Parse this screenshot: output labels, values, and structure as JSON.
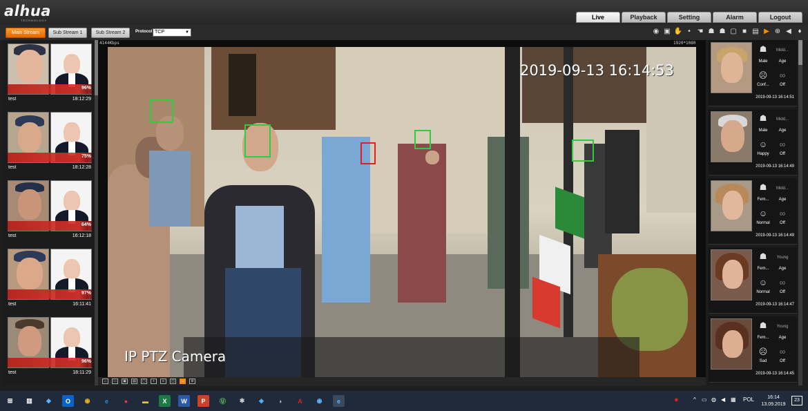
{
  "brand": {
    "logo": "alhua",
    "tagline": "TECHNOLOGY"
  },
  "nav": {
    "tabs": [
      "Live",
      "Playback",
      "Setting",
      "Alarm",
      "Logout"
    ],
    "active": "Live"
  },
  "streams": {
    "main": "Main Stream",
    "sub1": "Sub Stream 1",
    "sub2": "Sub Stream 2"
  },
  "protocol": {
    "label": "Protocol",
    "value": "TCP"
  },
  "video": {
    "bitrate": "4144Kbps",
    "resolution": "1920*1080",
    "timestamp": "2019-09-13 16:14:53",
    "camera_name": "IP PTZ Camera"
  },
  "matches": [
    {
      "percent": "96%",
      "name": "test",
      "time": "18:12:29"
    },
    {
      "percent": "75%",
      "name": "test",
      "time": "18:12:28"
    },
    {
      "percent": "64%",
      "name": "test",
      "time": "16:12:18"
    },
    {
      "percent": "97%",
      "name": "test",
      "time": "16:11:41"
    },
    {
      "percent": "96%",
      "name": "test",
      "time": "18:11:29"
    }
  ],
  "detections": [
    {
      "age_label": "Midd...",
      "gender": "Male",
      "age": "Age",
      "expression": "Conf...",
      "glasses": "Off",
      "datetime": "2019-09-13 16:14:51"
    },
    {
      "age_label": "Midd...",
      "gender": "Male",
      "age": "Age",
      "expression": "Happy",
      "glasses": "Off",
      "datetime": "2019-09-13 16:14:49"
    },
    {
      "age_label": "Midd...",
      "gender": "Fem...",
      "age": "Age",
      "expression": "Normal",
      "glasses": "Off",
      "datetime": "2019-09-13 16:14:49"
    },
    {
      "age_label": "Young",
      "gender": "Fem...",
      "age": "Age",
      "expression": "Normal",
      "glasses": "Off",
      "datetime": "2019-09-13 16:14:47"
    },
    {
      "age_label": "Young",
      "gender": "Fem...",
      "age": "Age",
      "expression": "Sad",
      "glasses": "Off",
      "datetime": "2019-09-13 16:14:45"
    }
  ],
  "taskbar": {
    "tray_lang": "POL",
    "clock_time": "16:14",
    "clock_date": "13.09.2019",
    "notifications": "23"
  },
  "colors": {
    "accent": "#ff8a00",
    "match_bar": "#d8322a",
    "face_box": "#2ecc40",
    "face_box_alert": "#e02020"
  }
}
